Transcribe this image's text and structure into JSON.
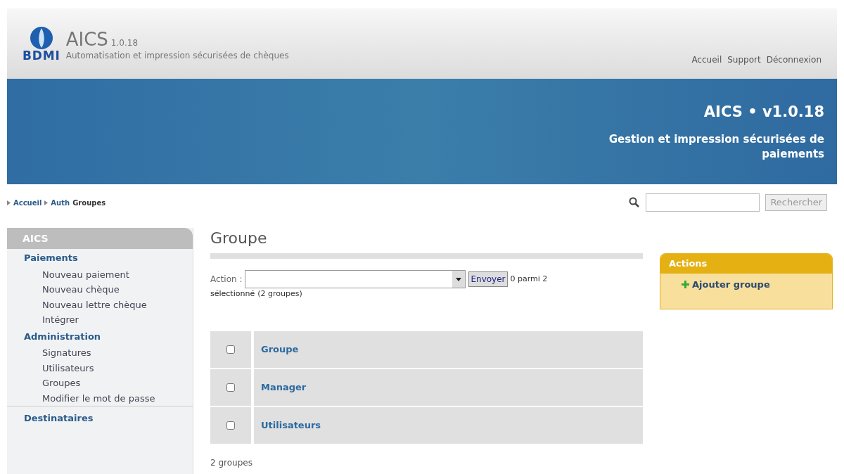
{
  "header": {
    "brand": "BDMI",
    "title": "AICS",
    "version": "1.0.18",
    "subtitle": "Automatisation et impression sécurisées de chèques",
    "links": [
      "Accueil",
      "Support",
      "Déconnexion"
    ]
  },
  "banner": {
    "title": "AICS • v1.0.18",
    "subtitle": "Gestion et impression sécurisées de paiements"
  },
  "breadcrumb": [
    {
      "label": "Accueil",
      "kind": "link"
    },
    {
      "label": "Auth",
      "kind": "link"
    },
    {
      "label": "Groupes",
      "kind": "current"
    }
  ],
  "search": {
    "button": "Rechercher"
  },
  "sidebar": {
    "title": "AICS",
    "sections": [
      {
        "label": "Paiements",
        "children": [
          {
            "label": "Nouveau paiement"
          },
          {
            "label": "Nouveau chèque"
          },
          {
            "label": "Nouveau lettre chèque"
          },
          {
            "label": "Intégrer"
          }
        ]
      },
      {
        "label": "Administration",
        "children": [
          {
            "label": "Signatures"
          },
          {
            "label": "Utilisateurs"
          },
          {
            "label": "Groupes"
          },
          {
            "label": "Modifier le mot de passe"
          }
        ]
      },
      {
        "label": "Destinataires"
      }
    ]
  },
  "main": {
    "title": "Groupe",
    "action_label": "Action :",
    "action_button": "Envoyer",
    "selection_count": "0 parmi 2",
    "selection_text": "sélectionné",
    "selection_all": "(2 groupes)",
    "rows": [
      {
        "label": "Groupe",
        "checked": false
      },
      {
        "label": "Manager",
        "checked": false
      },
      {
        "label": "Utilisateurs",
        "checked": false
      }
    ],
    "footer": "2 groupes"
  },
  "actions": {
    "title": "Actions",
    "items": [
      "Ajouter groupe"
    ]
  }
}
